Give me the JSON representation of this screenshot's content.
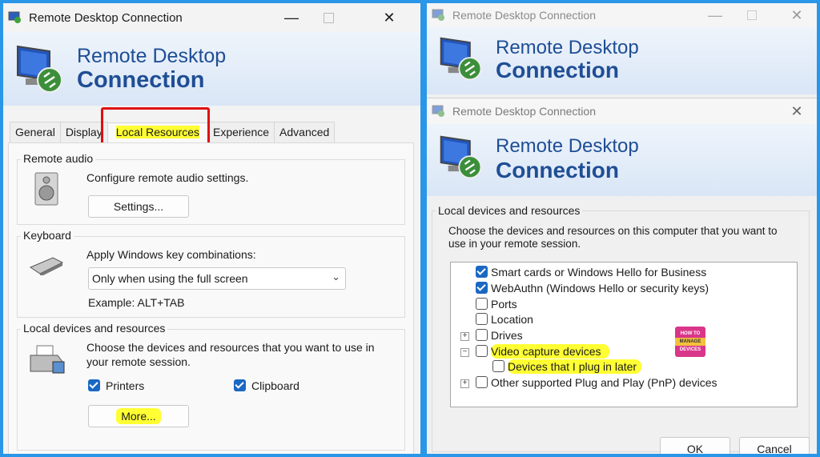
{
  "left": {
    "title": "Remote Desktop Connection",
    "banner_line1": "Remote Desktop",
    "banner_line2": "Connection",
    "tabs": [
      "General",
      "Display",
      "Local Resources",
      "Experience",
      "Advanced"
    ],
    "remote_audio": {
      "label": "Remote audio",
      "desc": "Configure remote audio settings.",
      "button": "Settings..."
    },
    "keyboard": {
      "label": "Keyboard",
      "desc": "Apply Windows key combinations:",
      "selected": "Only when using the full screen",
      "example": "Example: ALT+TAB"
    },
    "local_devices": {
      "label": "Local devices and resources",
      "desc1": "Choose the devices and resources that you want to use in",
      "desc2": "your remote session.",
      "printers": "Printers",
      "clipboard": "Clipboard",
      "more": "More..."
    }
  },
  "right": {
    "back_title": "Remote Desktop Connection",
    "dialog_title": "Remote Desktop Connection",
    "banner_line1": "Remote Desktop",
    "banner_line2": "Connection",
    "group_label": "Local devices and resources",
    "desc1": "Choose the devices and resources on this computer that you want to",
    "desc2": "use in your remote session.",
    "items": [
      {
        "label": "Smart cards or Windows Hello for Business",
        "checked": true
      },
      {
        "label": "WebAuthn (Windows Hello or security keys)",
        "checked": true
      },
      {
        "label": "Ports",
        "checked": false
      },
      {
        "label": "Location",
        "checked": false
      },
      {
        "label": "Drives",
        "checked": false
      },
      {
        "label": "Video capture devices",
        "checked": false
      },
      {
        "label": "Devices that I plug in later",
        "checked": false
      },
      {
        "label": "Other supported Plug and Play (PnP) devices",
        "checked": false
      }
    ],
    "ok": "OK",
    "cancel": "Cancel",
    "watermark": {
      "line1": "HOW TO",
      "line2": "MANAGE",
      "line3": "DEVICES"
    }
  }
}
